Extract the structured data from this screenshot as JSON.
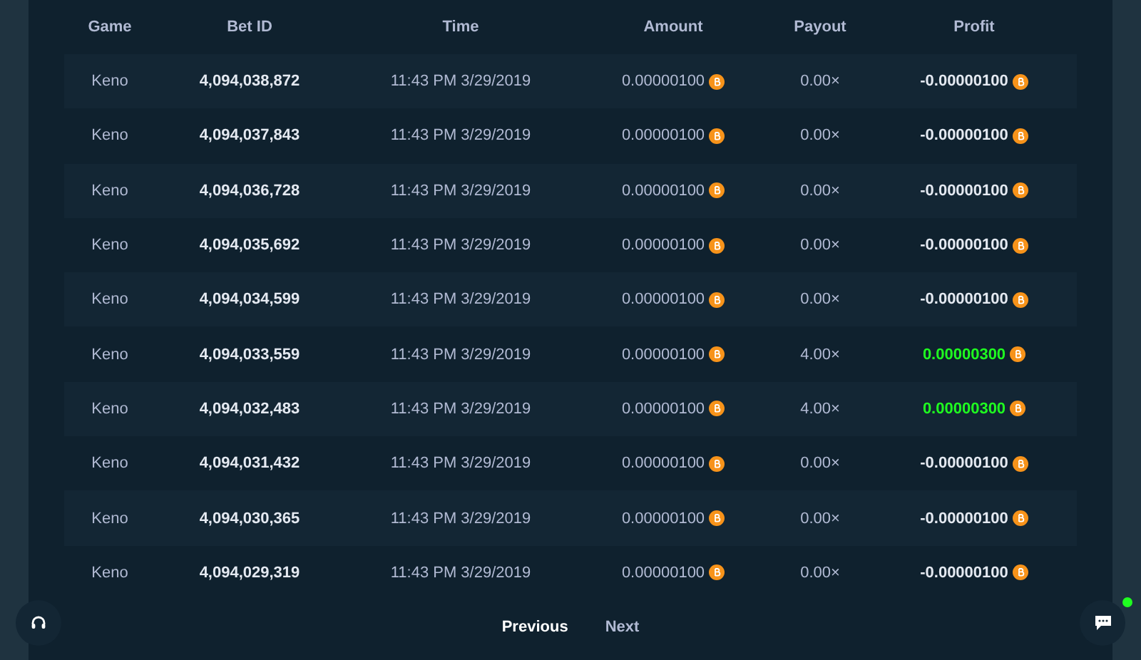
{
  "table": {
    "columns": [
      "Game",
      "Bet ID",
      "Time",
      "Amount",
      "Payout",
      "Profit"
    ],
    "rows": [
      {
        "game": "Keno",
        "bet_id": "4,094,038,872",
        "time": "11:43 PM 3/29/2019",
        "amount": "0.00000100",
        "payout": "0.00×",
        "profit": "-0.00000100",
        "win": false
      },
      {
        "game": "Keno",
        "bet_id": "4,094,037,843",
        "time": "11:43 PM 3/29/2019",
        "amount": "0.00000100",
        "payout": "0.00×",
        "profit": "-0.00000100",
        "win": false
      },
      {
        "game": "Keno",
        "bet_id": "4,094,036,728",
        "time": "11:43 PM 3/29/2019",
        "amount": "0.00000100",
        "payout": "0.00×",
        "profit": "-0.00000100",
        "win": false
      },
      {
        "game": "Keno",
        "bet_id": "4,094,035,692",
        "time": "11:43 PM 3/29/2019",
        "amount": "0.00000100",
        "payout": "0.00×",
        "profit": "-0.00000100",
        "win": false
      },
      {
        "game": "Keno",
        "bet_id": "4,094,034,599",
        "time": "11:43 PM 3/29/2019",
        "amount": "0.00000100",
        "payout": "0.00×",
        "profit": "-0.00000100",
        "win": false
      },
      {
        "game": "Keno",
        "bet_id": "4,094,033,559",
        "time": "11:43 PM 3/29/2019",
        "amount": "0.00000100",
        "payout": "4.00×",
        "profit": "0.00000300",
        "win": true
      },
      {
        "game": "Keno",
        "bet_id": "4,094,032,483",
        "time": "11:43 PM 3/29/2019",
        "amount": "0.00000100",
        "payout": "4.00×",
        "profit": "0.00000300",
        "win": true
      },
      {
        "game": "Keno",
        "bet_id": "4,094,031,432",
        "time": "11:43 PM 3/29/2019",
        "amount": "0.00000100",
        "payout": "0.00×",
        "profit": "-0.00000100",
        "win": false
      },
      {
        "game": "Keno",
        "bet_id": "4,094,030,365",
        "time": "11:43 PM 3/29/2019",
        "amount": "0.00000100",
        "payout": "0.00×",
        "profit": "-0.00000100",
        "win": false
      },
      {
        "game": "Keno",
        "bet_id": "4,094,029,319",
        "time": "11:43 PM 3/29/2019",
        "amount": "0.00000100",
        "payout": "0.00×",
        "profit": "-0.00000100",
        "win": false
      }
    ]
  },
  "pagination": [
    {
      "label": "Previous",
      "disabled": false
    },
    {
      "label": "Next",
      "disabled": true
    }
  ],
  "chat": {
    "online": true
  }
}
